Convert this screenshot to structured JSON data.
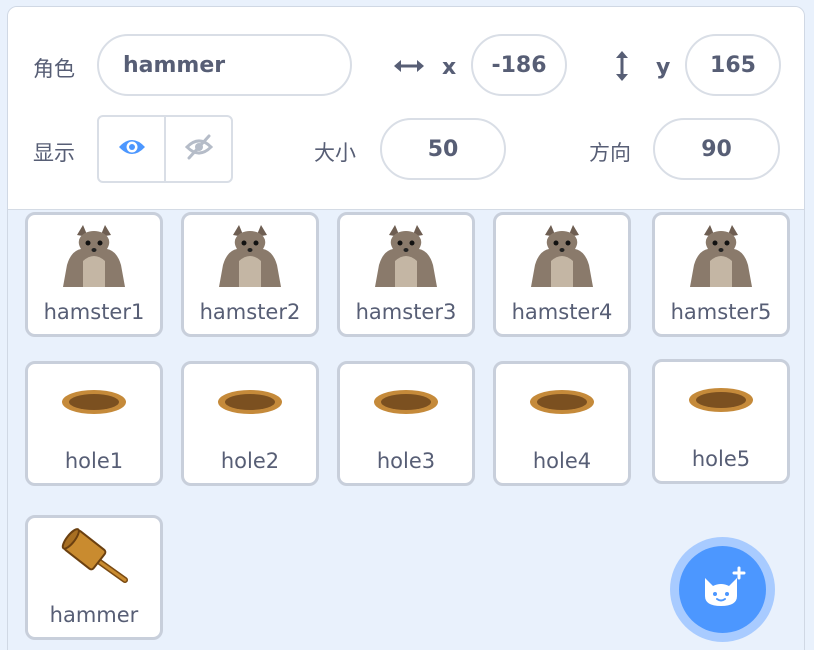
{
  "sprite_info": {
    "sprite_label": "角色",
    "sprite_name": "hammer",
    "x_label": "x",
    "x_value": "-186",
    "y_label": "y",
    "y_value": "165",
    "show_label": "显示",
    "size_label": "大小",
    "size_value": "50",
    "direction_label": "方向",
    "direction_value": "90",
    "visible": true,
    "accent_color": "#4c97ff"
  },
  "sprites": [
    {
      "name": "hamster1",
      "icon": "hamster-icon"
    },
    {
      "name": "hamster2",
      "icon": "hamster-icon"
    },
    {
      "name": "hamster3",
      "icon": "hamster-icon"
    },
    {
      "name": "hamster4",
      "icon": "hamster-icon"
    },
    {
      "name": "hamster5",
      "icon": "hamster-icon"
    },
    {
      "name": "hole1",
      "icon": "hole-icon"
    },
    {
      "name": "hole2",
      "icon": "hole-icon"
    },
    {
      "name": "hole3",
      "icon": "hole-icon"
    },
    {
      "name": "hole4",
      "icon": "hole-icon"
    },
    {
      "name": "hole5",
      "icon": "hole-icon"
    },
    {
      "name": "hammer",
      "icon": "hammer-icon"
    }
  ],
  "add_sprite_button": {
    "icon": "cat-plus-icon"
  }
}
